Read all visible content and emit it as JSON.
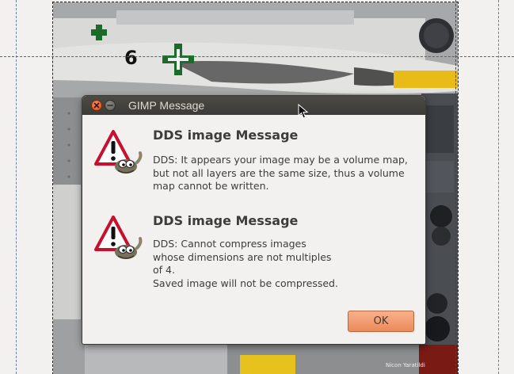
{
  "canvas": {
    "aircraft_number": "6",
    "corner_label": "Nicon Yaratildi"
  },
  "dialog": {
    "title": "GIMP Message",
    "messages": [
      {
        "heading": "DDS image Message",
        "body": "DDS: It appears your image may be a volume map,\nbut not all layers are the same size, thus a volume\nmap cannot be written.",
        "icon": "gimp-warning-icon"
      },
      {
        "heading": "DDS image Message",
        "body": "DDS: Cannot compress images\nwhose dimensions are not multiples\nof 4.\nSaved image will not be compressed.",
        "icon": "gimp-warning-icon"
      }
    ],
    "ok_label": "OK"
  },
  "colors": {
    "titlebar": "#3c3b37",
    "close": "#df4a16",
    "ok_button": "#f19a6c",
    "warning_triangle": "#c8102e"
  }
}
